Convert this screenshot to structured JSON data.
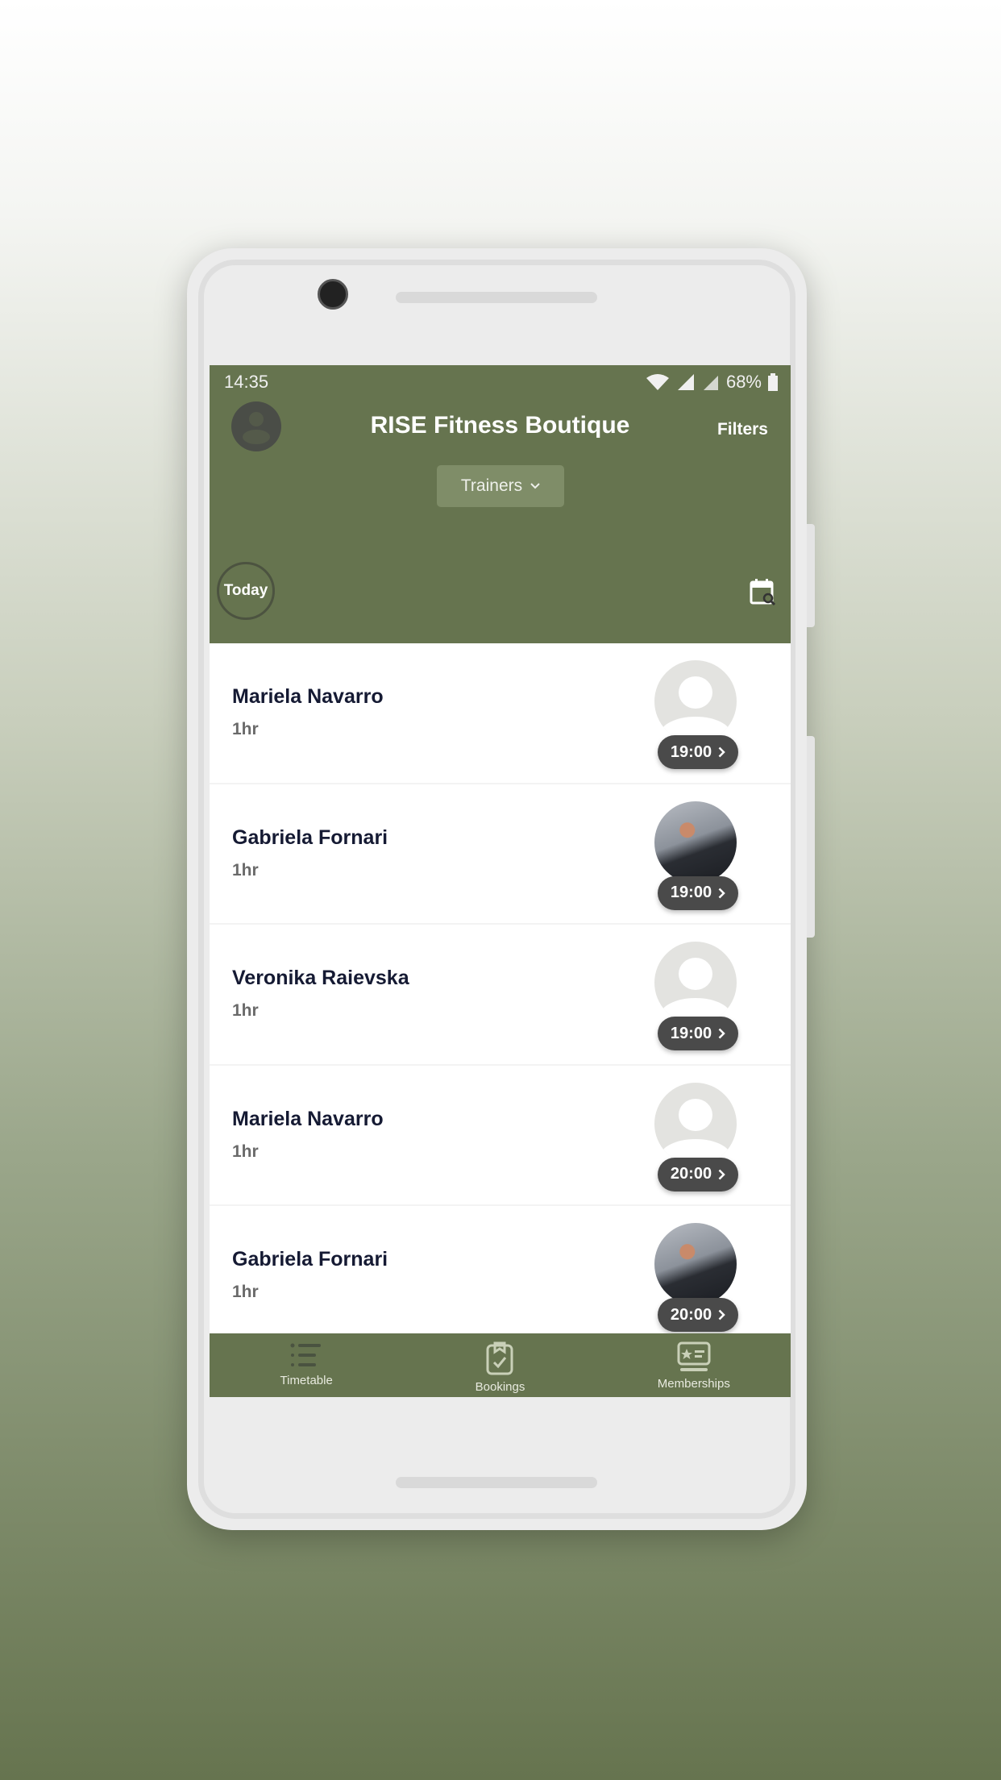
{
  "status": {
    "time": "14:35",
    "battery": "68%"
  },
  "header": {
    "title": "RISE Fitness Boutique",
    "filters_label": "Filters",
    "dropdown_label": "Trainers",
    "today_label": "Today"
  },
  "colors": {
    "brand": "#66744f",
    "pill": "#4a4a4a",
    "name": "#151a33"
  },
  "sessions": [
    {
      "name": "Mariela Navarro",
      "duration": "1hr",
      "time": "19:00",
      "avatar": "placeholder"
    },
    {
      "name": "Gabriela Fornari",
      "duration": "1hr",
      "time": "19:00",
      "avatar": "photo"
    },
    {
      "name": "Veronika Raievska",
      "duration": "1hr",
      "time": "19:00",
      "avatar": "placeholder"
    },
    {
      "name": "Mariela Navarro",
      "duration": "1hr",
      "time": "20:00",
      "avatar": "placeholder"
    },
    {
      "name": "Gabriela Fornari",
      "duration": "1hr",
      "time": "20:00",
      "avatar": "photo"
    }
  ],
  "nav": [
    {
      "label": "Timetable",
      "icon": "list-icon"
    },
    {
      "label": "Bookings",
      "icon": "clipboard-check-icon"
    },
    {
      "label": "Memberships",
      "icon": "membership-card-icon"
    }
  ]
}
